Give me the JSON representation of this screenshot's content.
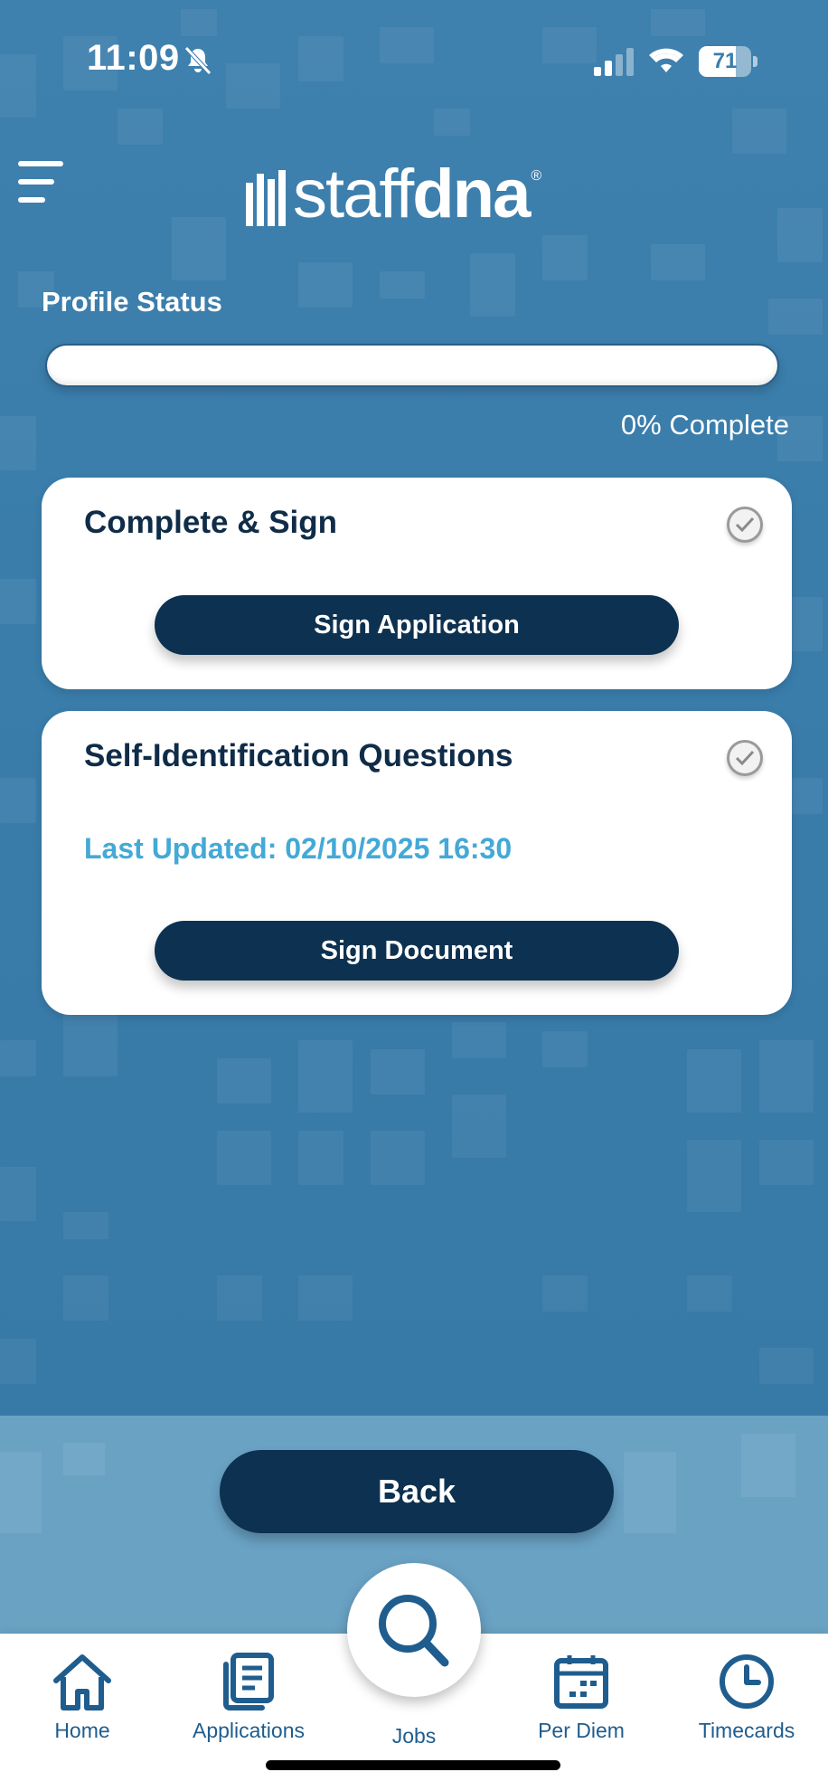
{
  "status_bar": {
    "time": "11:09",
    "battery_percent": "71",
    "battery_level": 0.71
  },
  "header": {
    "logo_light": "staff",
    "logo_bold": "dna",
    "logo_mark": "®"
  },
  "profile": {
    "label": "Profile Status",
    "progress_fraction": 0,
    "progress_text": "0% Complete"
  },
  "cards": [
    {
      "title": "Complete & Sign",
      "button_label": "Sign Application"
    },
    {
      "title": "Self-Identification Questions",
      "last_updated": "Last Updated: 02/10/2025 16:30",
      "button_label": "Sign Document"
    }
  ],
  "back_button": {
    "label": "Back"
  },
  "tabs": [
    {
      "label": "Home",
      "icon": "home-icon"
    },
    {
      "label": "Applications",
      "icon": "document-list-icon"
    },
    {
      "label": "Jobs",
      "icon": "search-icon"
    },
    {
      "label": "Per Diem",
      "icon": "calendar-icon"
    },
    {
      "label": "Timecards",
      "icon": "clock-icon"
    }
  ],
  "colors": {
    "background": "#3d7fae",
    "navy": "#0d3150",
    "accent_text": "#44a9d6",
    "tab_icon": "#1f5d8e"
  }
}
